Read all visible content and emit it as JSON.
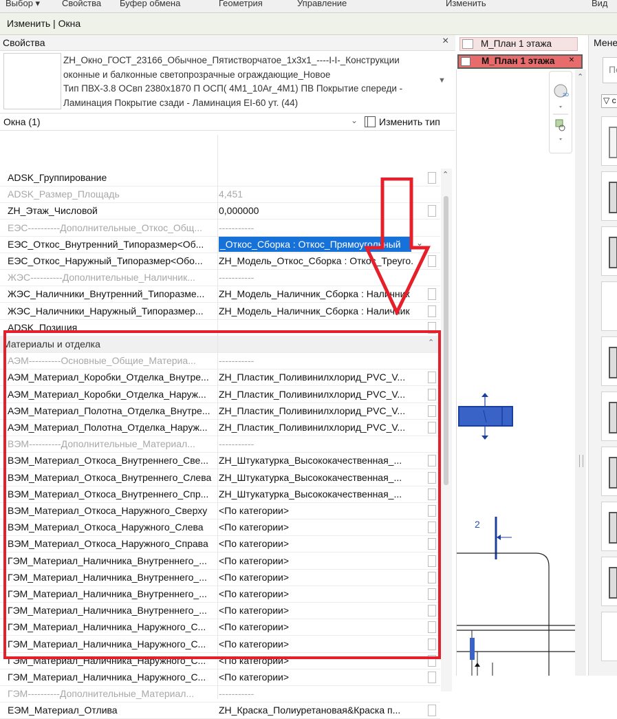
{
  "ribbon": {
    "items": [
      "Выбор ▾",
      "Свойства",
      "Буфер обмена",
      "Геометрия",
      "Управление",
      "Изменить",
      "Вид"
    ]
  },
  "context_bar": {
    "label": "Изменить | Окна"
  },
  "properties": {
    "title": "Свойства",
    "close": "×",
    "type_lines": [
      "ZH_Окно_ГОСТ_23166_Обычное_Пятистворчатое_1х3х1_----I-I-_Конструкции",
      "оконные и балконные светопрозрачные ограждающие_Новое",
      "Тип ПВХ-3.8 ОСвп 2380х1870 П ОСП( 4М1_10Ar_4М1) ПВ Покрытие спереди -",
      "Ламинация Покрытие сзади - Ламинация EI-60 ут. (44)"
    ],
    "category": "Окна (1)",
    "edit_type": "Изменить тип",
    "rows": [
      {
        "name": "ADSK_Группирование",
        "value": "",
        "kind": "normal"
      },
      {
        "name": "ADSK_Размер_Площадь",
        "value": "4,451",
        "kind": "dim"
      },
      {
        "name": "ZH_Этаж_Числовой",
        "value": "0,000000",
        "kind": "normal"
      },
      {
        "name": "ЕЭС----------Дополнительные_Откос_Общ...",
        "value": "-----------",
        "kind": "dim"
      },
      {
        "name": "ЕЭС_Откос_Внутренний_Типоразмер<Об...",
        "value": "_Откос_Сборка : Откос_Прямоугольный",
        "kind": "hl"
      },
      {
        "name": "ЕЭС_Откос_Наружный_Типоразмер<Обо...",
        "value": "ZH_Модель_Откос_Сборка : Откос_Треуго...",
        "kind": "normal"
      },
      {
        "name": "ЖЭС----------Дополнительные_Наличник...",
        "value": "-----------",
        "kind": "dim"
      },
      {
        "name": "ЖЭС_Наличники_Внутренний_Типоразме...",
        "value": "ZH_Модель_Наличник_Сборка : Наличник",
        "kind": "normal"
      },
      {
        "name": "ЖЭС_Наличники_Наружный_Типоразмер...",
        "value": "ZH_Модель_Наличник_Сборка : Наличник",
        "kind": "normal"
      },
      {
        "name": "ADSK_Позиция",
        "value": "",
        "kind": "normal"
      },
      {
        "name": "Материалы и отделка",
        "value": "",
        "kind": "grp"
      },
      {
        "name": "АЭМ----------Основные_Общие_Материа...",
        "value": "-----------",
        "kind": "dim"
      },
      {
        "name": "АЭМ_Материал_Коробки_Отделка_Внутре...",
        "value": "ZH_Пластик_Поливинилхлорид_PVC_V...",
        "kind": "normal"
      },
      {
        "name": "АЭМ_Материал_Коробки_Отделка_Наруж...",
        "value": "ZH_Пластик_Поливинилхлорид_PVC_V...",
        "kind": "normal"
      },
      {
        "name": "АЭМ_Материал_Полотна_Отделка_Внутре...",
        "value": "ZH_Пластик_Поливинилхлорид_PVC_V...",
        "kind": "normal"
      },
      {
        "name": "АЭМ_Материал_Полотна_Отделка_Наруж...",
        "value": "ZH_Пластик_Поливинилхлорид_PVC_V...",
        "kind": "normal"
      },
      {
        "name": "ВЭМ----------Дополнительные_Материал...",
        "value": "-----------",
        "kind": "dim"
      },
      {
        "name": "ВЭМ_Материал_Откоса_Внутреннего_Све...",
        "value": "ZH_Штукатурка_Высококачественная_...",
        "kind": "normal"
      },
      {
        "name": "ВЭМ_Материал_Откоса_Внутреннего_Слева",
        "value": "ZH_Штукатурка_Высококачественная_...",
        "kind": "normal"
      },
      {
        "name": "ВЭМ_Материал_Откоса_Внутреннего_Спр...",
        "value": "ZH_Штукатурка_Высококачественная_...",
        "kind": "normal"
      },
      {
        "name": "ВЭМ_Материал_Откоса_Наружного_Сверху",
        "value": "<По категории>",
        "kind": "normal"
      },
      {
        "name": "ВЭМ_Материал_Откоса_Наружного_Слева",
        "value": "<По категории>",
        "kind": "normal"
      },
      {
        "name": "ВЭМ_Материал_Откоса_Наружного_Справа",
        "value": "<По категории>",
        "kind": "normal"
      },
      {
        "name": "ГЭМ_Материал_Наличника_Внутреннего_...",
        "value": "<По категории>",
        "kind": "normal"
      },
      {
        "name": "ГЭМ_Материал_Наличника_Внутреннего_...",
        "value": "<По категории>",
        "kind": "normal"
      },
      {
        "name": "ГЭМ_Материал_Наличника_Внутреннего_...",
        "value": "<По категории>",
        "kind": "normal"
      },
      {
        "name": "ГЭМ_Материал_Наличника_Внутреннего_...",
        "value": "<По категории>",
        "kind": "normal"
      },
      {
        "name": "ГЭМ_Материал_Наличника_Наружного_С...",
        "value": "<По категории>",
        "kind": "normal"
      },
      {
        "name": "ГЭМ_Материал_Наличника_Наружного_С...",
        "value": "<По категории>",
        "kind": "normal"
      },
      {
        "name": "ГЭМ_Материал_Наличника_Наружного_С...",
        "value": "<По категории>",
        "kind": "normal"
      },
      {
        "name": "ГЭМ_Материал_Наличника_Наружного_С...",
        "value": "<По категории>",
        "kind": "normal"
      },
      {
        "name": "ГЭМ----------Дополнительные_Материал...",
        "value": "-----------",
        "kind": "dim"
      },
      {
        "name": "ЕЭМ_Материал_Отлива",
        "value": "ZH_Краска_Полиуретановая&Краска п...",
        "kind": "normal"
      }
    ]
  },
  "tabs": [
    {
      "label": "М_План 1 этажа",
      "active": false
    },
    {
      "label": "М_План 1 этажа",
      "active": true,
      "close": "×"
    }
  ],
  "view": {
    "dim_label": "2"
  },
  "right_panel": {
    "title": "Менеджер",
    "search_placeholder": "По",
    "filter": "▽ с"
  },
  "colors": {
    "highlight": "#1672d8",
    "annotation": "#e5202b",
    "active_tab": "#e96c6c",
    "element_blue": "#3a63c7"
  }
}
